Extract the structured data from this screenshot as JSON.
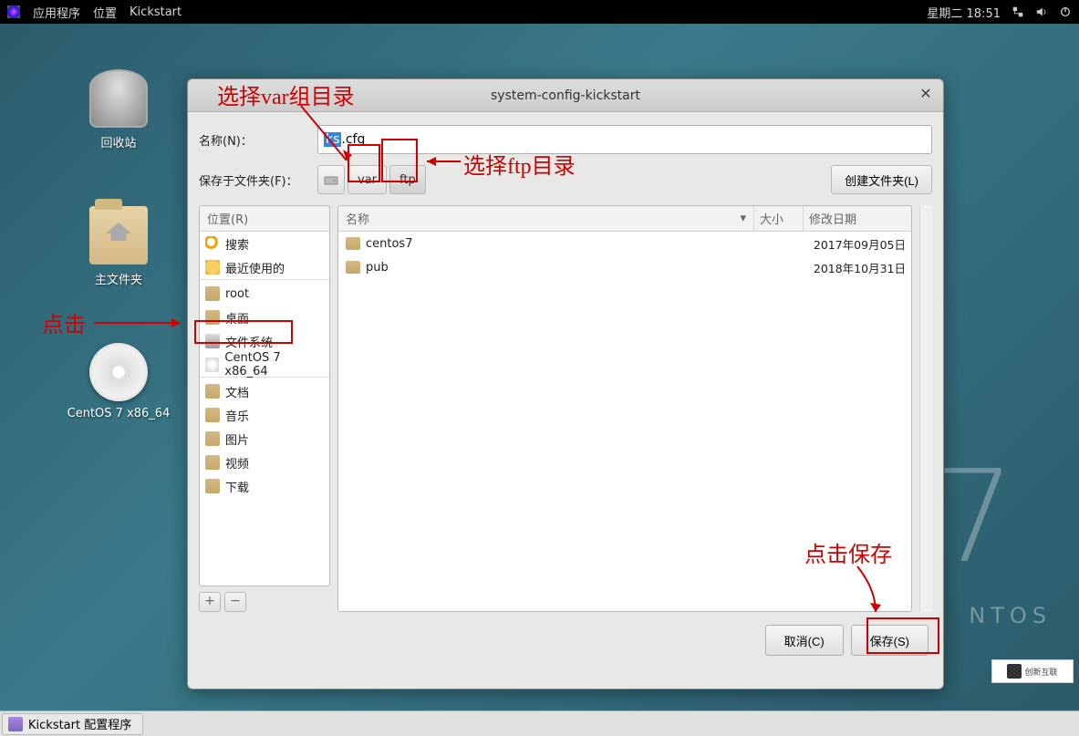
{
  "topbar": {
    "apps": "应用程序",
    "places": "位置",
    "kickstart": "Kickstart",
    "datetime": "星期二 18:51"
  },
  "desktop": {
    "trash": "回收站",
    "home": "主文件夹",
    "centos": "CentOS 7 x86_64"
  },
  "dialog": {
    "title": "system-config-kickstart",
    "name_label": "名称(N)：",
    "name_selected": "ks",
    "name_rest": ".cfg",
    "folder_label": "保存于文件夹(F)：",
    "crumbs": {
      "disk": "",
      "var": "var",
      "ftp": "ftp"
    },
    "create_folder": "创建文件夹(L)",
    "sidebar_header": "位置(R)",
    "sidebar": {
      "search": "搜索",
      "recent": "最近使用的",
      "root": "root",
      "desktop": "桌面",
      "filesystem": "文件系统",
      "centos": "CentOS 7 x86_64",
      "documents": "文档",
      "music": "音乐",
      "pictures": "图片",
      "videos": "视频",
      "downloads": "下载"
    },
    "add_btn": "+",
    "remove_btn": "−",
    "list_header": {
      "name": "名称",
      "size": "大小",
      "date": "修改日期"
    },
    "files": [
      {
        "name": "centos7",
        "size": "",
        "date": "2017年09月05日"
      },
      {
        "name": "pub",
        "size": "",
        "date": "2018年10月31日"
      }
    ],
    "cancel": "取消(C)",
    "save": "保存(S)"
  },
  "annotations": {
    "a1": "选择var组目录",
    "a2": "选择ftp目录",
    "a3": "点击",
    "a4": "点击保存"
  },
  "taskbar": {
    "item": "Kickstart 配置程序"
  },
  "watermark": "创新互联",
  "centos_text": "NTOS"
}
